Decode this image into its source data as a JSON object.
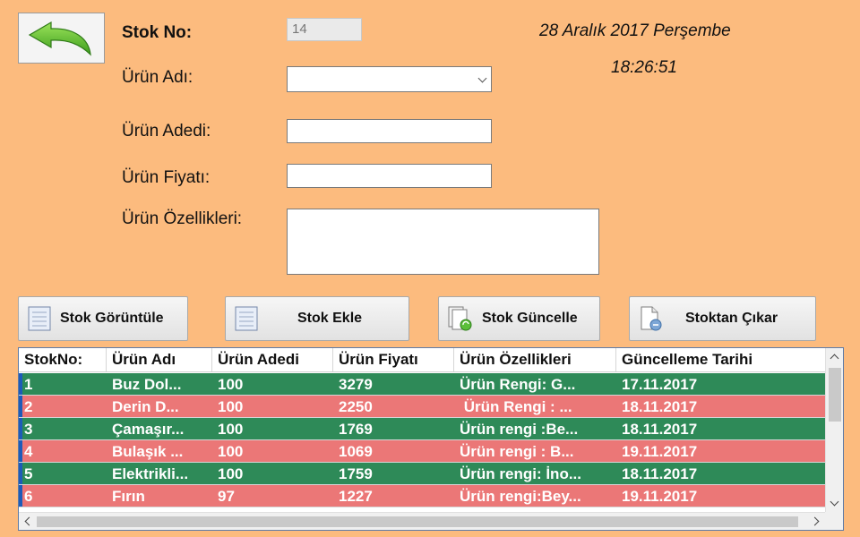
{
  "form": {
    "stok_no_label": "Stok No:",
    "stok_no_value": "14",
    "urun_adi_label": "Ürün Adı:",
    "urun_adi_value": "",
    "urun_adedi_label": "Ürün Adedi:",
    "urun_adedi_value": "",
    "urun_fiyati_label": "Ürün Fiyatı:",
    "urun_fiyati_value": "",
    "urun_ozellikleri_label": "Ürün Özellikleri:",
    "urun_ozellikleri_value": ""
  },
  "clock": {
    "date": "28 Aralık 2017 Perşembe",
    "time": "18:26:51"
  },
  "buttons": {
    "back_icon": "back-arrow-icon",
    "goruntule": "Stok Görüntüle",
    "ekle": "Stok Ekle",
    "guncelle": "Stok Güncelle",
    "cikar": "Stoktan Çıkar"
  },
  "grid": {
    "columns": [
      "StokNo:",
      "Ürün Adı",
      "Ürün Adedi",
      "Ürün Fiyatı",
      "Ürün Özellikleri",
      "Güncelleme Tarihi"
    ],
    "rows": [
      [
        "1",
        "Buz Dol...",
        "100",
        "3279",
        "Ürün Rengi: G...",
        "17.11.2017"
      ],
      [
        "2",
        "Derin D...",
        "100",
        "2250",
        " Ürün Rengi : ...",
        "18.11.2017"
      ],
      [
        "3",
        "Çamaşır...",
        "100",
        "1769",
        "Ürün rengi :Be...",
        "18.11.2017"
      ],
      [
        "4",
        "Bulaşık ...",
        "100",
        "1069",
        "Ürün rengi : B...",
        "19.11.2017"
      ],
      [
        "5",
        "Elektrikli...",
        "100",
        "1759",
        "Ürün rengi: İno...",
        "18.11.2017"
      ],
      [
        "6",
        "Fırın",
        "97",
        "1227",
        "Ürün rengi:Bey...",
        "19.11.2017"
      ]
    ]
  },
  "colors": {
    "background": "#FCBB7E",
    "row_green": "#2E8A58",
    "row_red": "#EB7777"
  }
}
